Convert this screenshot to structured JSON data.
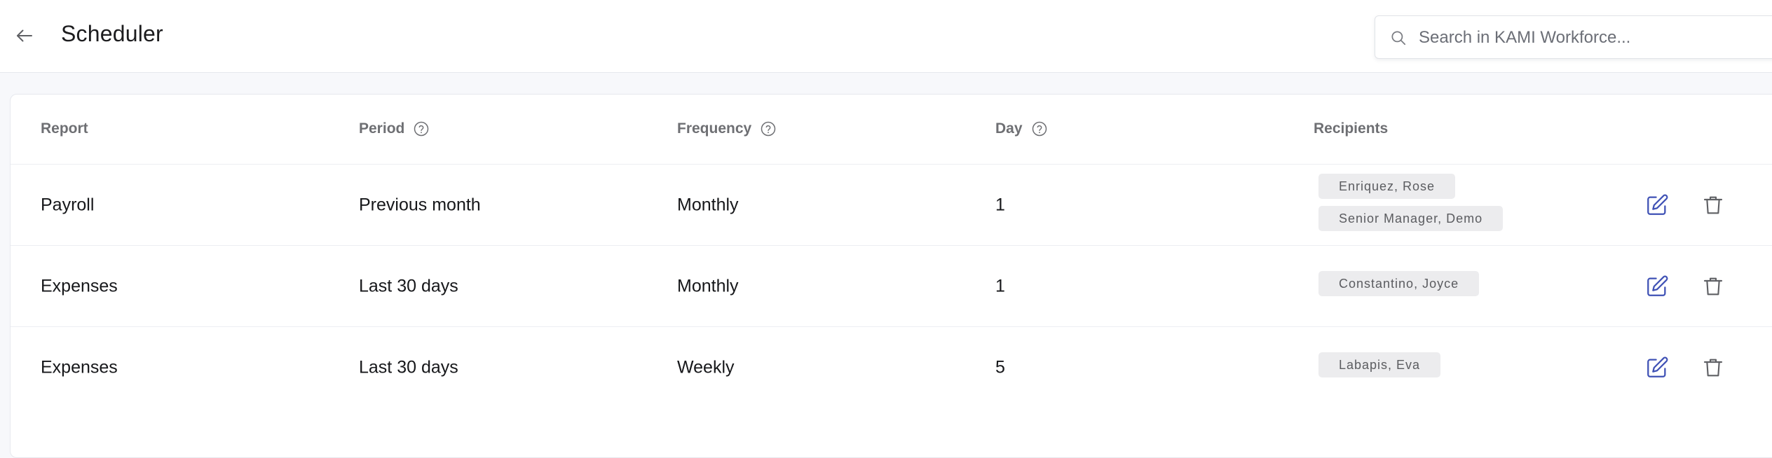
{
  "header": {
    "title": "Scheduler",
    "back_icon": "arrow-left-icon",
    "search": {
      "placeholder": "Search in KAMI Workforce...",
      "value": "",
      "icon": "search-icon"
    }
  },
  "table": {
    "columns": [
      {
        "label": "Report",
        "has_help": false
      },
      {
        "label": "Period",
        "has_help": true
      },
      {
        "label": "Frequency",
        "has_help": true
      },
      {
        "label": "Day",
        "has_help": true
      },
      {
        "label": "Recipients",
        "has_help": false
      }
    ],
    "rows": [
      {
        "report": "Payroll",
        "period": "Previous month",
        "frequency": "Monthly",
        "day": "1",
        "recipients": [
          "Enriquez, Rose",
          "Senior Manager, Demo"
        ]
      },
      {
        "report": "Expenses",
        "period": "Last 30 days",
        "frequency": "Monthly",
        "day": "1",
        "recipients": [
          "Constantino, Joyce"
        ]
      },
      {
        "report": "Expenses",
        "period": "Last 30 days",
        "frequency": "Weekly",
        "day": "5",
        "recipients": [
          "Labapis, Eva"
        ]
      }
    ],
    "row_actions": [
      "edit-icon",
      "trash-icon"
    ]
  },
  "colors": {
    "accent": "#3f51b5",
    "icon_gray": "#5f6064",
    "chip_bg": "#ececee",
    "header_text": "#6e6f73"
  }
}
